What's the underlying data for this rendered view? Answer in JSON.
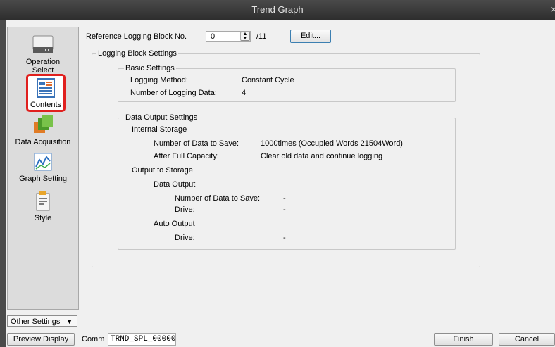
{
  "window": {
    "title": "Trend Graph",
    "close_glyph": "×"
  },
  "sidebar": {
    "items": [
      {
        "label": "Operation Select",
        "icon": "operation-select-icon"
      },
      {
        "label": "Contents",
        "icon": "contents-icon",
        "selected": true
      },
      {
        "label": "Data Acquisition",
        "icon": "data-acquisition-icon"
      },
      {
        "label": "Graph Setting",
        "icon": "graph-setting-icon"
      },
      {
        "label": "Style",
        "icon": "style-icon"
      }
    ],
    "other_settings": "Other Settings",
    "other_settings_arrow": "▼",
    "highlight_color": "#e0201e"
  },
  "reference": {
    "label": "Reference Logging Block No.",
    "value": "0",
    "max": "/11",
    "edit_button": "Edit..."
  },
  "logging_block": {
    "title": "Logging Block Settings",
    "basic": {
      "title": "Basic Settings",
      "method_label": "Logging Method:",
      "method_value": "Constant Cycle",
      "count_label": "Number of Logging Data:",
      "count_value": "4"
    },
    "output": {
      "title": "Data Output Settings",
      "internal_storage": "Internal Storage",
      "data_to_save_label": "Number of Data to Save:",
      "data_to_save_value": "1000times (Occupied Words 21504Word)",
      "after_full_label": "After Full Capacity:",
      "after_full_value": "Clear old data and continue logging",
      "output_to_storage": "Output to Storage",
      "data_output": "Data Output",
      "do_save_label": "Number of Data to Save:",
      "do_save_value": "-",
      "do_drive_label": "Drive:",
      "do_drive_value": "-",
      "auto_output": "Auto Output",
      "ao_drive_label": "Drive:",
      "ao_drive_value": "-"
    }
  },
  "footer": {
    "preview_button": "Preview Display",
    "comm_label": "Comm",
    "comm_value": "TRND_SPL_00000",
    "finish_button": "Finish",
    "cancel_button": "Cancel"
  }
}
